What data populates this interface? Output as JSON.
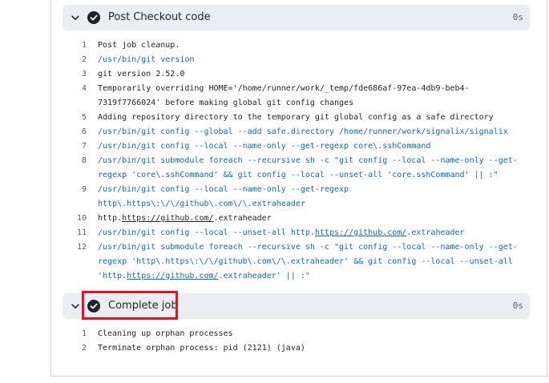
{
  "steps": [
    {
      "title": "Post Checkout code",
      "duration": "0s",
      "lines": [
        {
          "n": "1",
          "type": "out",
          "text": "Post job cleanup."
        },
        {
          "n": "2",
          "type": "cmd",
          "text": "/usr/bin/git version"
        },
        {
          "n": "3",
          "type": "out",
          "text": "git version 2.52.0"
        },
        {
          "n": "4",
          "type": "out",
          "text": "Temporarily overriding HOME='/home/runner/work/_temp/fde686af-97ea-4db9-beb4-"
        },
        {
          "n": "",
          "type": "out",
          "text": "7319f7766024' before making global git config changes"
        },
        {
          "n": "5",
          "type": "out",
          "text": "Adding repository directory to the temporary git global config as a safe directory"
        },
        {
          "n": "6",
          "type": "cmd",
          "text": "/usr/bin/git config --global --add safe.directory /home/runner/work/signalix/signalix"
        },
        {
          "n": "7",
          "type": "cmd",
          "text": "/usr/bin/git config --local --name-only --get-regexp core\\.sshCommand"
        },
        {
          "n": "8",
          "type": "cmd",
          "text": "/usr/bin/git submodule foreach --recursive sh -c \"git config --local --name-only --get-"
        },
        {
          "n": "",
          "type": "cmd",
          "text": "regexp 'core\\.sshCommand' && git config --local --unset-all 'core.sshCommand' || :\""
        },
        {
          "n": "9",
          "type": "cmd",
          "text": "/usr/bin/git config --local --name-only --get-regexp"
        },
        {
          "n": "",
          "type": "cmd",
          "text": "http\\.https\\:\\/\\/github\\.com\\/\\.extraheader"
        },
        {
          "n": "10",
          "type": "out",
          "pre": "http.",
          "link": "https://github.com/",
          "post": ".extraheader"
        },
        {
          "n": "11",
          "type": "cmd",
          "pre": "/usr/bin/git config --local --unset-all http.",
          "link": "https://github.com/",
          "post": ".extraheader"
        },
        {
          "n": "12",
          "type": "cmd",
          "text": "/usr/bin/git submodule foreach --recursive sh -c \"git config --local --name-only --get-"
        },
        {
          "n": "",
          "type": "cmd",
          "text": "regexp 'http\\.https\\:\\/\\/github\\.com\\/\\.extraheader' && git config --local --unset-all"
        },
        {
          "n": "",
          "type": "cmd",
          "pre": "'http.",
          "link": "https://github.com/",
          "post": ".extraheader' || :\""
        }
      ]
    },
    {
      "title": "Complete job",
      "duration": "0s",
      "lines": [
        {
          "n": "1",
          "type": "out",
          "text": "Cleaning up orphan processes"
        },
        {
          "n": "2",
          "type": "out",
          "text": "Terminate orphan process: pid (2121) (java)"
        }
      ]
    }
  ],
  "colors": {
    "command": "#0969da",
    "highlight": "#e5131b",
    "header_bg": "#eaeef2"
  }
}
